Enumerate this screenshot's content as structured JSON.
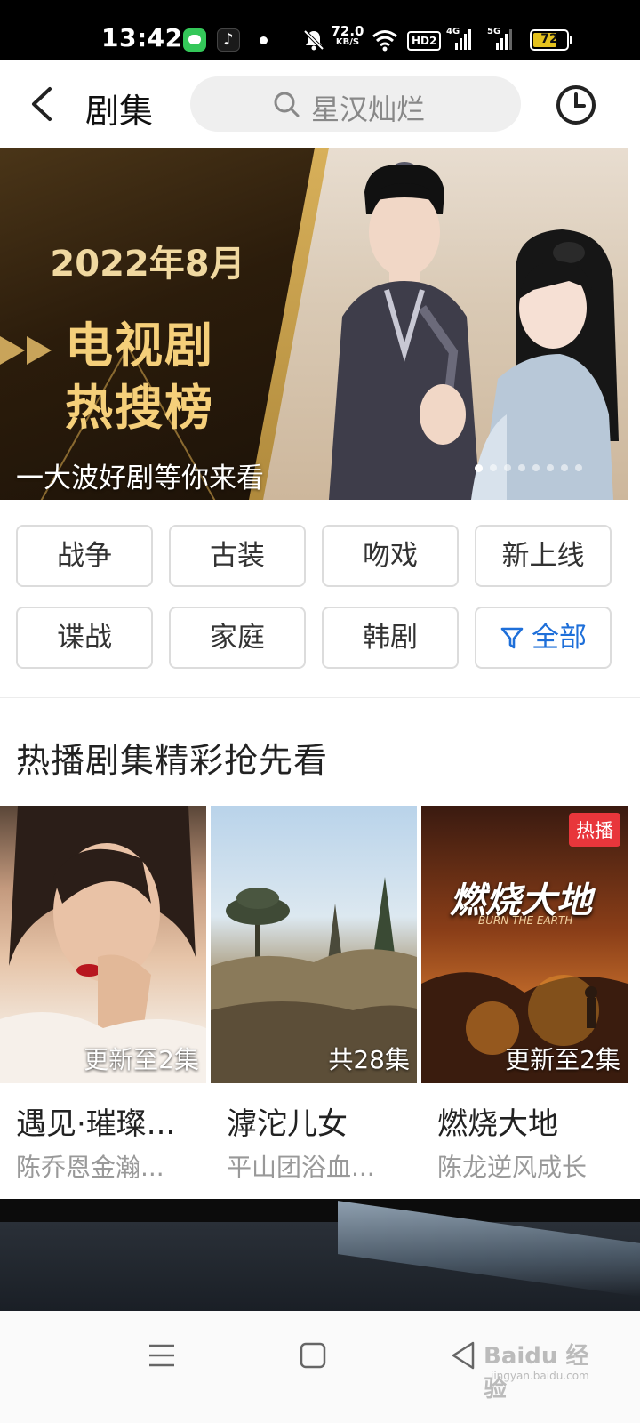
{
  "status_bar": {
    "time": "13:42",
    "tiktok_glyph": "♪",
    "speed_value": "72.0",
    "speed_unit": "KB/S",
    "hd_label": "HD2",
    "net1": "4G",
    "net2": "5G",
    "battery": "72"
  },
  "header": {
    "title": "剧集",
    "search_placeholder": "星汉灿烂"
  },
  "banner": {
    "year_month": "2022年8月",
    "headline_line1": "电视剧",
    "headline_line2": "热搜榜",
    "caption": "一大波好剧等你来看",
    "slide_count": 8,
    "active_slide": 1
  },
  "categories": [
    {
      "label": "战争"
    },
    {
      "label": "古装"
    },
    {
      "label": "吻戏"
    },
    {
      "label": "新上线"
    },
    {
      "label": "谍战"
    },
    {
      "label": "家庭"
    },
    {
      "label": "韩剧"
    },
    {
      "label": "全部",
      "icon": "filter-icon",
      "accent": "#1e6fd9"
    }
  ],
  "section": {
    "title": "热播剧集精彩抢先看"
  },
  "cards": [
    {
      "title": "遇见·璀璨...",
      "subtitle": "陈乔恩金瀚...",
      "episodes": "更新至2集",
      "badge": ""
    },
    {
      "title": "滹沱儿女",
      "subtitle": "平山团浴血...",
      "episodes": "共28集",
      "badge": ""
    },
    {
      "title": "燃烧大地",
      "subtitle": "陈龙逆风成长",
      "episodes": "更新至2集",
      "badge": "热播",
      "poster_text": "燃烧大地",
      "poster_subtext": "BURN THE EARTH"
    }
  ],
  "colors": {
    "accent": "#1e6fd9",
    "hot_badge": "#e8363b",
    "banner_gold": "#f5cf7a"
  },
  "watermark": {
    "brand": "Baidu 经验",
    "url": "jingyan.baidu.com"
  }
}
